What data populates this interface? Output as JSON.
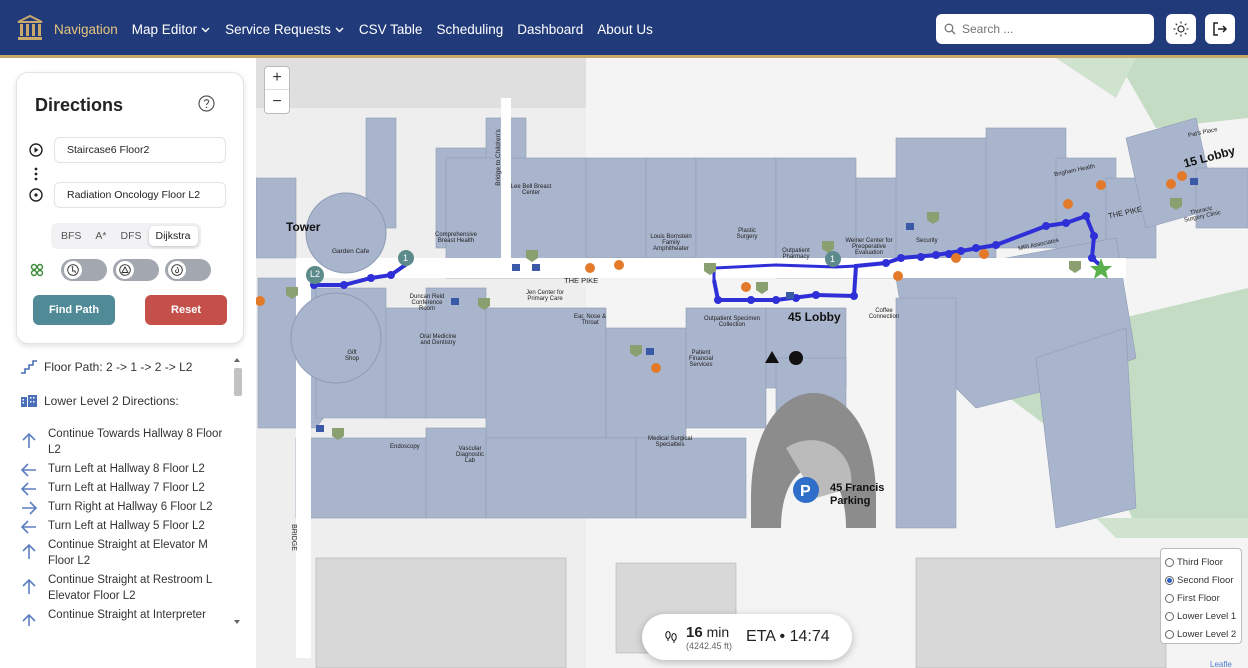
{
  "nav": {
    "items": [
      {
        "label": "Navigation",
        "active": true,
        "dropdown": false
      },
      {
        "label": "Map Editor",
        "active": false,
        "dropdown": true
      },
      {
        "label": "Service Requests",
        "active": false,
        "dropdown": true
      },
      {
        "label": "CSV Table",
        "active": false,
        "dropdown": false
      },
      {
        "label": "Scheduling",
        "active": false,
        "dropdown": false
      },
      {
        "label": "Dashboard",
        "active": false,
        "dropdown": false
      },
      {
        "label": "About Us",
        "active": false,
        "dropdown": false
      }
    ],
    "search_placeholder": "Search ..."
  },
  "directions": {
    "title": "Directions",
    "start": "Staircase6 Floor2",
    "end": "Radiation Oncology Floor L2",
    "algorithms": [
      "BFS",
      "A*",
      "DFS",
      "Dijkstra"
    ],
    "selected_algorithm": "Dijkstra",
    "find_label": "Find Path",
    "reset_label": "Reset"
  },
  "route": {
    "floor_path": "Floor Path: 2 -> 1 -> 2 -> L2",
    "level_heading": "Lower Level 2 Directions:",
    "steps": [
      {
        "dir": "up",
        "text": "Continue Towards Hallway 8 Floor L2"
      },
      {
        "dir": "left",
        "text": "Turn Left at Hallway 8 Floor L2"
      },
      {
        "dir": "left",
        "text": "Turn Left at Hallway 7 Floor L2"
      },
      {
        "dir": "right",
        "text": "Turn Right at Hallway 6 Floor L2"
      },
      {
        "dir": "left",
        "text": "Turn Left at Hallway 5 Floor L2"
      },
      {
        "dir": "up",
        "text": "Continue Straight at Elevator M Floor L2"
      },
      {
        "dir": "up",
        "text": "Continue Straight at Restroom L Elevator Floor L2"
      },
      {
        "dir": "up",
        "text": "Continue Straight at Interpreter"
      }
    ]
  },
  "map": {
    "labels": {
      "tower": "Tower",
      "lobby45": "45 Lobby",
      "lobby15": "15 Lobby",
      "parking": "45 Francis Parking",
      "the_pike": "THE PIKE",
      "the_pike2": "THE PIKE",
      "bridge": "BRIDGE",
      "bridge_children": "Bridge to Children's",
      "garden_cafe": "Garden Cafe",
      "comp_breast": "Comprehensive Breast Health",
      "lee_bell": "Lee Bell Breast Center",
      "louis_bornstein": "Louis Bornstein Family Amphitheater",
      "plastic_surgery": "Plastic Surgery",
      "outpatient_pharmacy": "Outpatient Pharmacy",
      "weiner": "Weiner Center for Preoperative Evaluation",
      "duncan_reid": "Duncan Reid Conference Room",
      "jen_center": "Jen Center for Primary Care",
      "ear_nose": "Ear, Nose & Throat",
      "outpatient_specimen": "Outpatient Specimen Collection",
      "coffee": "Coffee Connection",
      "oral_medicine": "Oral Medicine and Dentistry",
      "gift_shop": "Gift Shop",
      "patient_financial": "Patient Financial Services",
      "endoscopy": "Endoscopy",
      "vascular": "Vascular Diagnostic Lab",
      "med_surg": "Medical Surgical Specialties",
      "mri": "MRI Associates",
      "brigham_health": "Brigham Health",
      "paris_place": "Pat's Place",
      "thoracic": "Thoracic Surgery Clinic",
      "security": "Security",
      "l2_marker": "L2",
      "floor_marker_1": "1",
      "floor_marker_2": "1",
      "leaflet": "Leafle"
    },
    "floors": [
      {
        "label": "Third Floor",
        "selected": false
      },
      {
        "label": "Second Floor",
        "selected": true
      },
      {
        "label": "First Floor",
        "selected": false
      },
      {
        "label": "Lower Level 1",
        "selected": false
      },
      {
        "label": "Lower Level 2",
        "selected": false
      }
    ]
  },
  "eta": {
    "minutes": "16",
    "unit": "min",
    "distance": "(4242.45 ft)",
    "clock": "ETA • 14:74"
  },
  "colors": {
    "navbar": "#213a7a",
    "nav_active": "#e8c57c",
    "route": "#2e2fd6",
    "building": "#a9b5cc",
    "find_button": "#4f8a96",
    "reset_button": "#c5504a"
  }
}
